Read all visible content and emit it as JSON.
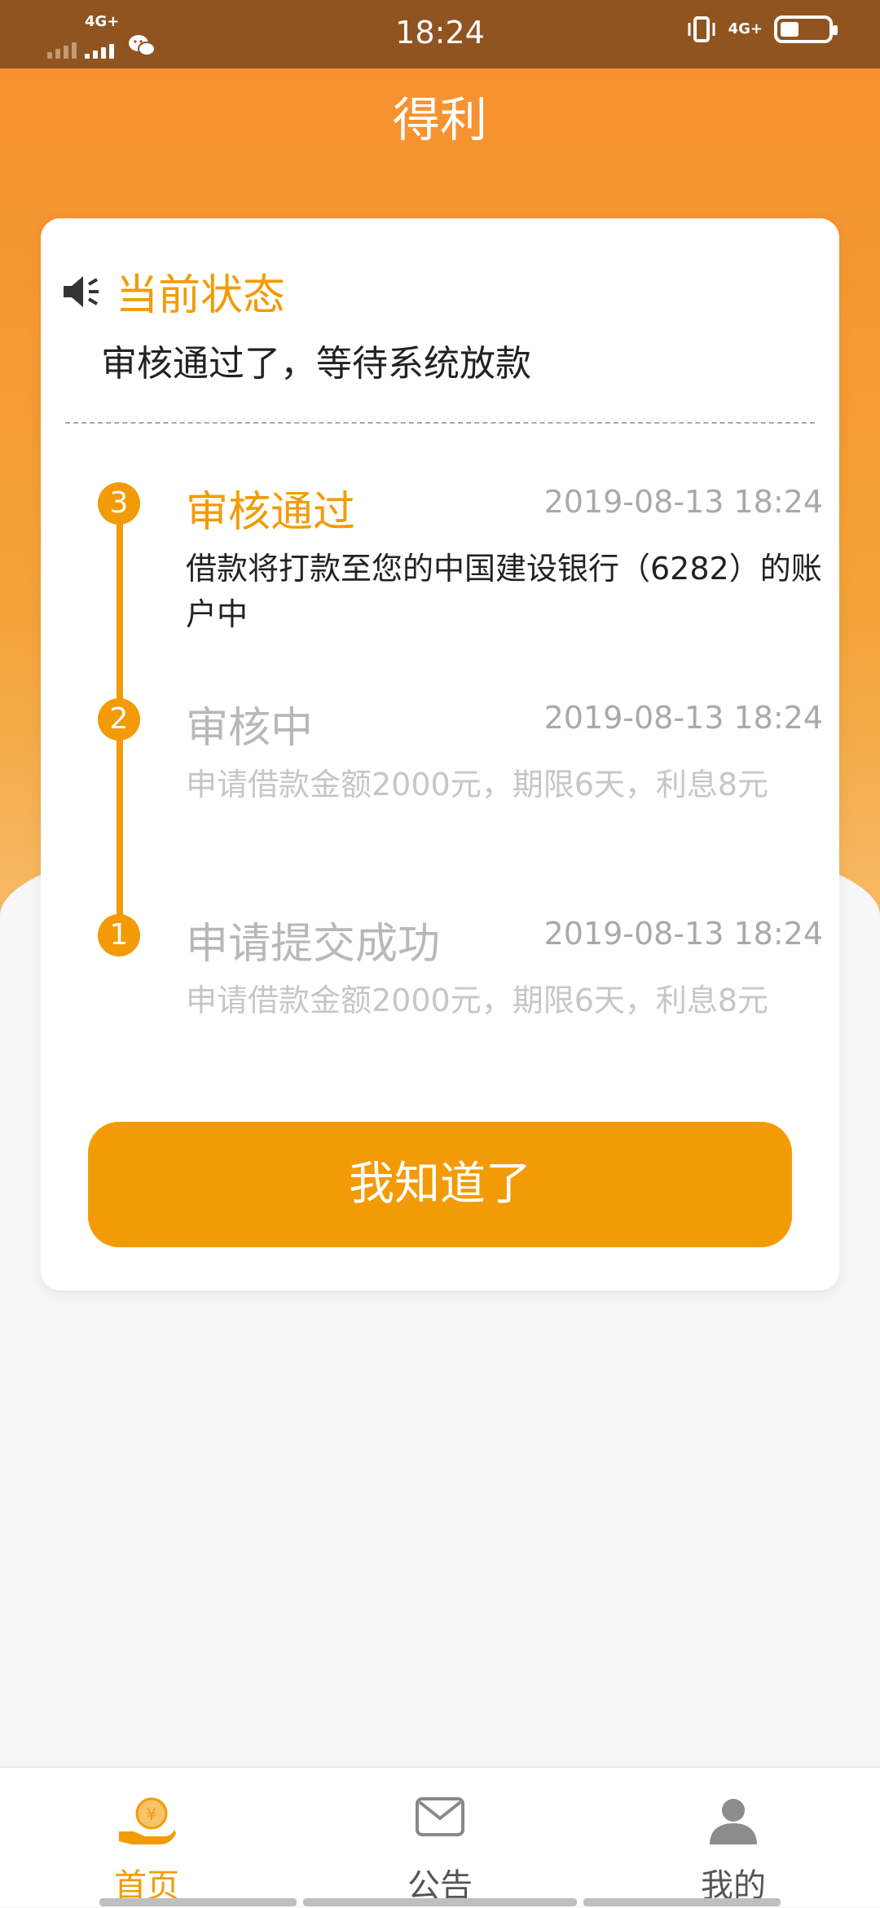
{
  "status_bar": {
    "time": "18:24",
    "net_left": "4G+",
    "net_right": "4G+"
  },
  "header": {
    "title": "得利"
  },
  "current_status": {
    "label": "当前状态",
    "text": "审核通过了，等待系统放款"
  },
  "steps": [
    {
      "number": "3",
      "title": "审核通过",
      "time": "2019-08-13 18:24",
      "desc": "借款将打款至您的中国建设银行（6282）的账户中"
    },
    {
      "number": "2",
      "title": "审核中",
      "time": "2019-08-13 18:24",
      "desc": "申请借款金额2000元，期限6天，利息8元"
    },
    {
      "number": "1",
      "title": "申请提交成功",
      "time": "2019-08-13 18:24",
      "desc": "申请借款金额2000元，期限6天，利息8元"
    }
  ],
  "confirm_button": {
    "label": "我知道了"
  },
  "tabs": [
    {
      "label": "首页",
      "icon": "coin-hand-icon"
    },
    {
      "label": "公告",
      "icon": "mail-icon"
    },
    {
      "label": "我的",
      "icon": "user-icon"
    }
  ],
  "colors": {
    "accent": "#f29b06",
    "status_bar": "#8f5420",
    "header_start": "#f6912f"
  }
}
